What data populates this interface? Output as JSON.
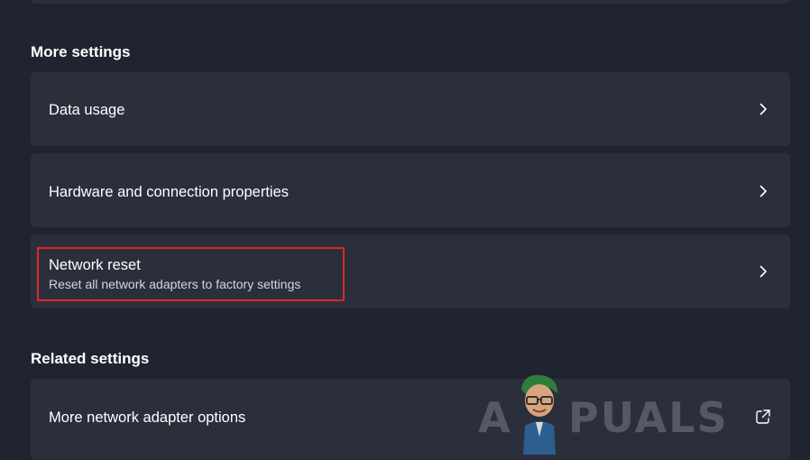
{
  "sections": {
    "more_settings": "More settings",
    "related_settings": "Related settings"
  },
  "cards": {
    "data_usage": {
      "title": "Data usage",
      "icon": "chevron-right-icon"
    },
    "hardware": {
      "title": "Hardware and connection properties",
      "icon": "chevron-right-icon"
    },
    "network_reset": {
      "title": "Network reset",
      "subtitle": "Reset all network adapters to factory settings",
      "icon": "chevron-right-icon",
      "highlighted": true,
      "highlight_color": "#e0262b"
    },
    "adapter_options": {
      "title": "More network adapter options",
      "icon": "open-external-icon"
    }
  },
  "watermark": {
    "text_a": "A",
    "text_b": "PUALS"
  },
  "colors": {
    "background": "#202431",
    "card": "#2b2f3c",
    "text": "#ffffff",
    "subtext": "#d4d6dc"
  }
}
